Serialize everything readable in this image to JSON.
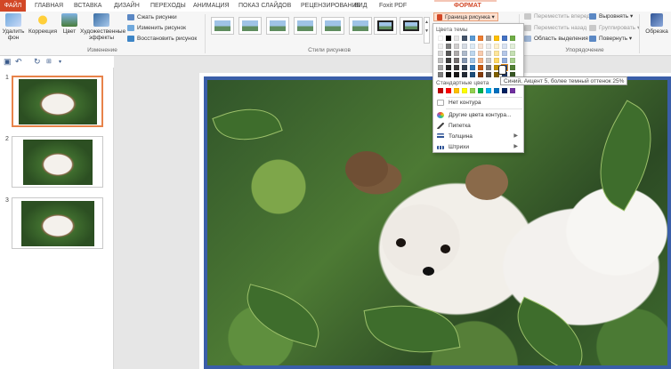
{
  "tabs": [
    {
      "label": "ФАЙЛ",
      "active": false
    },
    {
      "label": "ГЛАВНАЯ"
    },
    {
      "label": "ВСТАВКА"
    },
    {
      "label": "ДИЗАЙН"
    },
    {
      "label": "ПЕРЕХОДЫ"
    },
    {
      "label": "АНИМАЦИЯ"
    },
    {
      "label": "ПОКАЗ СЛАЙДОВ"
    },
    {
      "label": "РЕЦЕНЗИРОВАНИЕ"
    },
    {
      "label": "ВИД"
    },
    {
      "label": "Foxit PDF"
    },
    {
      "label": "ФОРМАТ",
      "active": true
    }
  ],
  "ribbon": {
    "remove_bg": "Удалить фон",
    "correction": "Коррекция",
    "color": "Цвет",
    "artistic": "Художественные эффекты",
    "compress": "Сжать рисунки",
    "change": "Изменить рисунок",
    "reset": "Восстановить рисунок",
    "group_change": "Изменение",
    "group_styles": "Стили рисунков",
    "border_btn": "Граница рисунка",
    "bring_forward": "Переместить вперед",
    "send_backward": "Переместить назад",
    "selection_pane": "Область выделения",
    "align": "Выровнять",
    "group": "Группировать",
    "rotate": "Повернуть",
    "group_arrange": "Упорядочение",
    "crop": "Обрезка"
  },
  "dropdown": {
    "theme_colors_label": "Цвета темы",
    "standard_colors_label": "Стандартные цвета",
    "no_outline": "Нет контура",
    "more_colors": "Другие цвета контура...",
    "eyedropper": "Пипетка",
    "weight": "Толщина",
    "dashes": "Штрихи",
    "tooltip": "Синий, Акцент 5, более темный оттенок 25%",
    "theme_top": [
      "#ffffff",
      "#000000",
      "#e7e6e6",
      "#44546a",
      "#5b9bd5",
      "#ed7d31",
      "#a5a5a5",
      "#ffc000",
      "#4472c4",
      "#70ad47"
    ],
    "theme_shades": [
      [
        "#f2f2f2",
        "#7f7f7f",
        "#d0cece",
        "#d6dce4",
        "#deebf6",
        "#fbe5d5",
        "#ededed",
        "#fff2cc",
        "#dae3f3",
        "#e2efd9"
      ],
      [
        "#d8d8d8",
        "#595959",
        "#aeabab",
        "#adb9ca",
        "#bdd7ee",
        "#f8cbad",
        "#dbdbdb",
        "#fee599",
        "#b4c6e7",
        "#c5e0b3"
      ],
      [
        "#bfbfbf",
        "#3f3f3f",
        "#757070",
        "#8496b0",
        "#9dc3e6",
        "#f4b183",
        "#c9c9c9",
        "#ffd965",
        "#8eaadb",
        "#a8d08d"
      ],
      [
        "#a5a5a5",
        "#262626",
        "#3a3838",
        "#323f4f",
        "#2e75b5",
        "#c55a11",
        "#7b7b7b",
        "#bf9000",
        "#2f5496",
        "#538135"
      ],
      [
        "#7f7f7f",
        "#0c0c0c",
        "#171616",
        "#222a35",
        "#1e4e79",
        "#833c0b",
        "#525252",
        "#7f6000",
        "#1f3864",
        "#375623"
      ]
    ],
    "standard": [
      "#c00000",
      "#ff0000",
      "#ffc000",
      "#ffff00",
      "#92d050",
      "#00b050",
      "#00b0f0",
      "#0070c0",
      "#002060",
      "#7030a0"
    ]
  },
  "slides": [
    {
      "num": "1"
    },
    {
      "num": "2"
    },
    {
      "num": "3"
    }
  ],
  "colors": {
    "accent": "#d24726",
    "picture_border": "#3a5ea8",
    "selected_thumb": "#e8834a"
  }
}
